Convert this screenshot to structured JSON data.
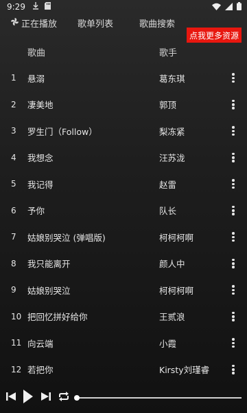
{
  "status_bar": {
    "time": "9:29",
    "icons": [
      "download-icon",
      "sd-card-icon",
      "wifi-icon",
      "signal-icon",
      "battery-icon"
    ]
  },
  "tabs": {
    "playing": "正在播放",
    "playlist": "歌单列表",
    "search": "歌曲搜索",
    "playing_icon": "pinwheel-icon"
  },
  "more_button": "点我更多资源",
  "header": {
    "song": "歌曲",
    "artist": "歌手"
  },
  "songs": [
    {
      "num": "1",
      "title": "悬溺",
      "artist": "葛东琪"
    },
    {
      "num": "2",
      "title": "凄美地",
      "artist": "郭顶"
    },
    {
      "num": "3",
      "title": "罗生门（Follow）",
      "artist": "梨冻紧"
    },
    {
      "num": "4",
      "title": "我想念",
      "artist": "汪苏泷"
    },
    {
      "num": "5",
      "title": "我记得",
      "artist": "赵雷"
    },
    {
      "num": "6",
      "title": "予你",
      "artist": "队长"
    },
    {
      "num": "7",
      "title": "姑娘别哭泣 (弹唱版)",
      "artist": "柯柯柯啊"
    },
    {
      "num": "8",
      "title": "我只能离开",
      "artist": "颜人中"
    },
    {
      "num": "9",
      "title": "姑娘别哭泣",
      "artist": "柯柯柯啊"
    },
    {
      "num": "10",
      "title": "把回忆拼好给你",
      "artist": "王贰浪"
    },
    {
      "num": "11",
      "title": "向云端",
      "artist": "小霞"
    },
    {
      "num": "12",
      "title": "若把你",
      "artist": "Kirsty刘瑾睿"
    }
  ],
  "player": {
    "progress": 0,
    "accent": "#e8170f"
  }
}
